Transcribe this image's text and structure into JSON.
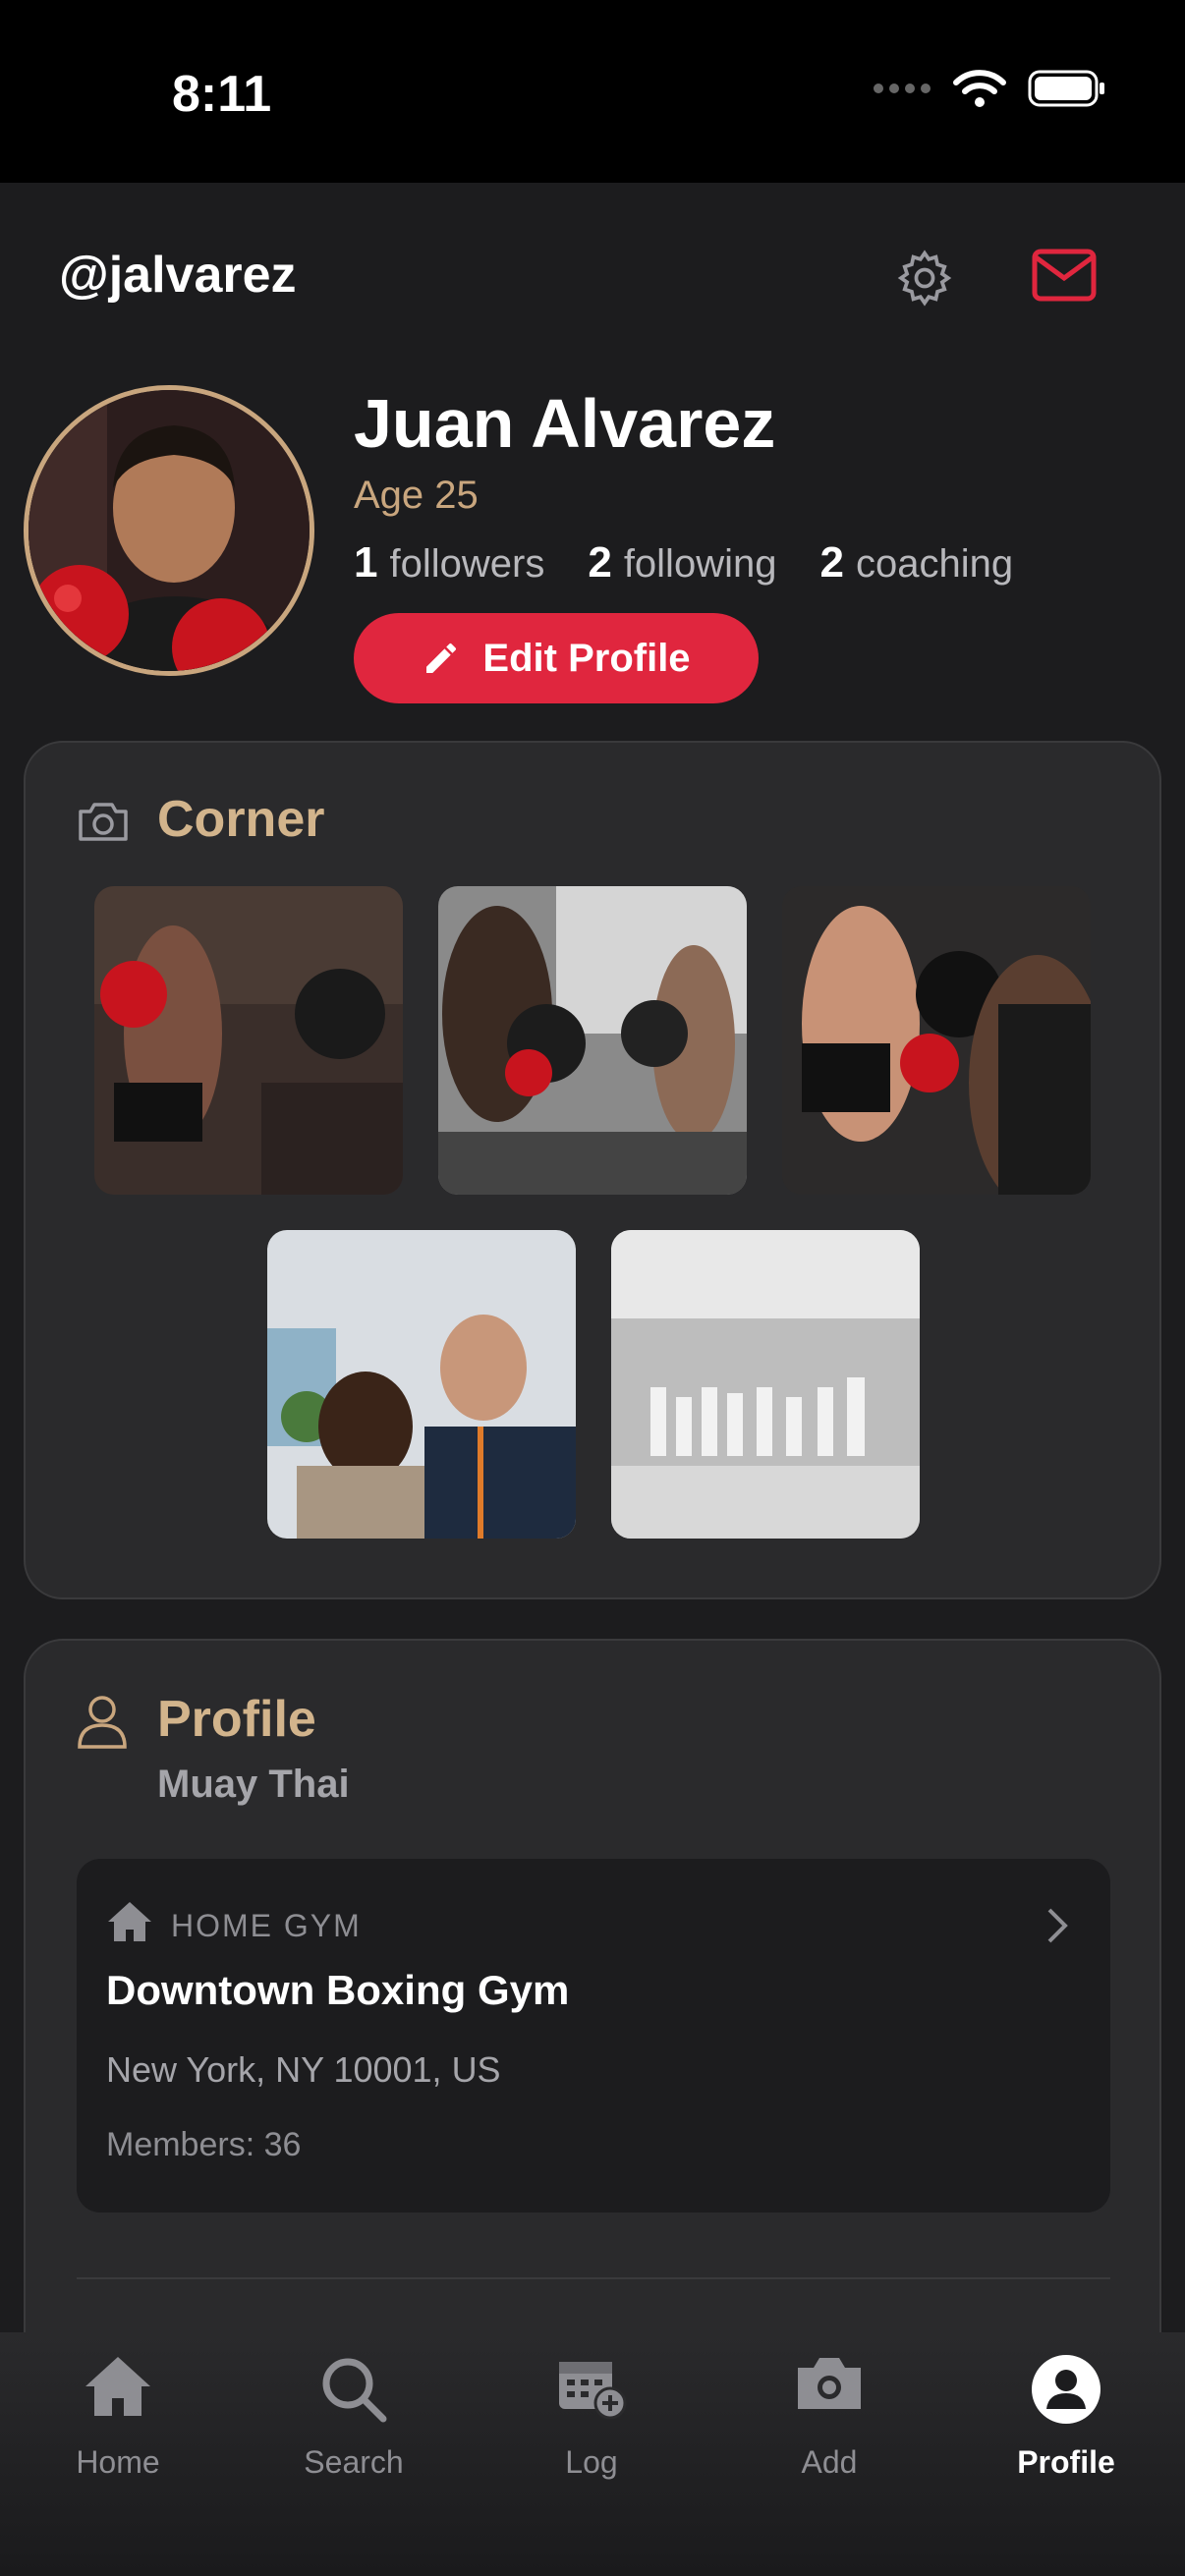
{
  "status": {
    "time": "8:11"
  },
  "header": {
    "handle": "@jalvarez",
    "settings_icon": "gear-icon",
    "inbox_icon": "envelope-icon"
  },
  "profile": {
    "name": "Juan Alvarez",
    "age": "Age 25",
    "stats": [
      {
        "count": "1",
        "label": "followers"
      },
      {
        "count": "2",
        "label": "following"
      },
      {
        "count": "2",
        "label": "coaching"
      }
    ],
    "edit_label": "Edit Profile"
  },
  "corner": {
    "title": "Corner",
    "photo_count": 5
  },
  "profile_card": {
    "title": "Profile",
    "discipline": "Muay Thai",
    "home_gym": {
      "label": "HOME GYM",
      "name": "Downtown Boxing Gym",
      "address": "New York, NY 10001, US",
      "members": "Members: 36"
    }
  },
  "tabs": [
    {
      "label": "Home",
      "icon": "house-icon"
    },
    {
      "label": "Search",
      "icon": "search-icon"
    },
    {
      "label": "Log",
      "icon": "calendar-add-icon"
    },
    {
      "label": "Add",
      "icon": "camera-icon"
    },
    {
      "label": "Profile",
      "icon": "person-circle-icon",
      "active": true
    }
  ],
  "colors": {
    "accent": "#e0263e",
    "gold": "#c9a67e",
    "background": "#1c1c1e",
    "card": "#2a2a2c"
  }
}
